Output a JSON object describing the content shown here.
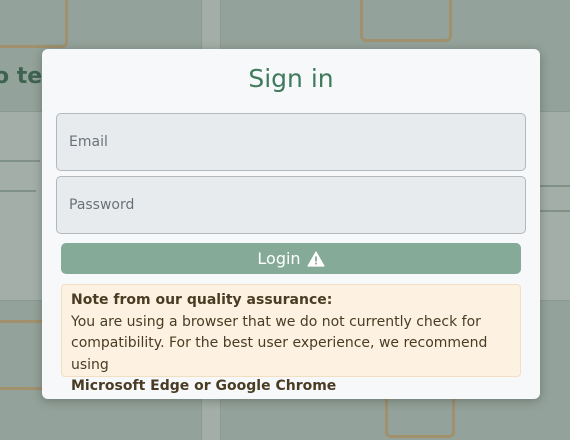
{
  "modal": {
    "title": "Sign in",
    "email_placeholder": "Email",
    "password_placeholder": "Password",
    "login_label": "Login",
    "login_icon": "warning-triangle-icon"
  },
  "note": {
    "title": "Note from our quality assurance:",
    "body": "You are using a browser that we do not currently check for compatibility. For the best user experience, we recommend using",
    "browsers": "Microsoft Edge or Google Chrome"
  },
  "background": {
    "heading_fragment": "o te"
  },
  "colors": {
    "title": "#3f7a5c",
    "button": "#86aa98",
    "note_bg": "#fdf1e1",
    "note_text": "#4a3c22"
  }
}
